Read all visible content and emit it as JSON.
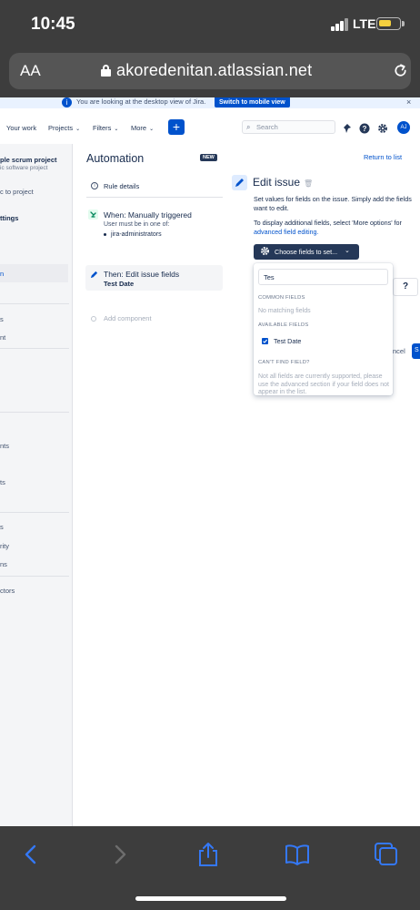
{
  "status": {
    "time": "10:45",
    "network": "LTE"
  },
  "browser": {
    "text_size": "AA",
    "domain": "akoredenitan.atlassian.net"
  },
  "banner": {
    "text": "You are looking at the desktop view of Jira.",
    "button": "Switch to mobile view",
    "close": "×"
  },
  "topnav": {
    "your_work": "Your work",
    "projects": "Projects",
    "filters": "Filters",
    "more": "More",
    "create": "+",
    "search_placeholder": "Search",
    "avatar_initials": "AJ"
  },
  "sidebar": {
    "project_name": "ple scrum project",
    "project_type": "ic software project",
    "back_link": "c to project",
    "settings": "ttings",
    "selected_item": "n",
    "items_a": [
      "s",
      "nt"
    ],
    "items_b": [
      "nts",
      "ts"
    ],
    "items_c": [
      "s",
      "rity",
      "ns"
    ],
    "items_d": [
      "ctors"
    ]
  },
  "automation": {
    "title": "Automation",
    "badge": "NEW",
    "rule_details": "Rule details",
    "trigger_title": "When: Manually triggered",
    "trigger_sub": "User must be in one of:",
    "trigger_group": "jira-administrators",
    "action_title": "Then: Edit issue fields",
    "action_field": "Test Date",
    "add_component": "Add component"
  },
  "edit_panel": {
    "title": "Edit issue",
    "return_link": "Return to list",
    "desc1": "Set values for fields on the issue. Simply add the fields want to edit.",
    "desc2": "To display additional fields, select 'More options' for",
    "desc2_link": "advanced field editing.",
    "choose_button": "Choose fields to set...",
    "help": "?",
    "cancel_fragment": "ncel",
    "save_fragment": "S"
  },
  "dropdown": {
    "search_value": "Tes",
    "common_header": "COMMON FIELDS",
    "no_match": "No matching fields",
    "available_header": "AVAILABLE FIELDS",
    "available_item": "Test Date",
    "available_item_checked": true,
    "cant_find_header": "CAN'T FIND FIELD?",
    "cant_find_text": "Not all fields are currently supported, please use the advanced section if your field does not appear in the list."
  },
  "colors": {
    "accent": "#0052cc",
    "navy": "#253858",
    "browser_chrome": "#3d3d3d",
    "ios_blue": "#3478f6",
    "battery": "#f4d03f"
  },
  "icons": [
    "back-icon",
    "forward-icon",
    "share-icon",
    "bookmarks-icon",
    "tabs-icon",
    "lock-icon",
    "reload-icon"
  ]
}
